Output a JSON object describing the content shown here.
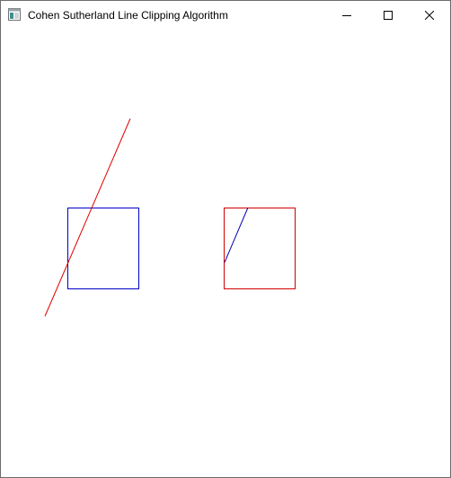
{
  "window": {
    "title": "Cohen Sutherland Line Clipping Algorithm",
    "controls": {
      "minimize_icon": "minimize-icon",
      "maximize_icon": "maximize-icon",
      "close_icon": "close-icon"
    }
  },
  "colors": {
    "before_window": "#0000c8",
    "before_line": "#e00000",
    "after_window": "#d00000",
    "after_line": "#0000b4"
  }
}
